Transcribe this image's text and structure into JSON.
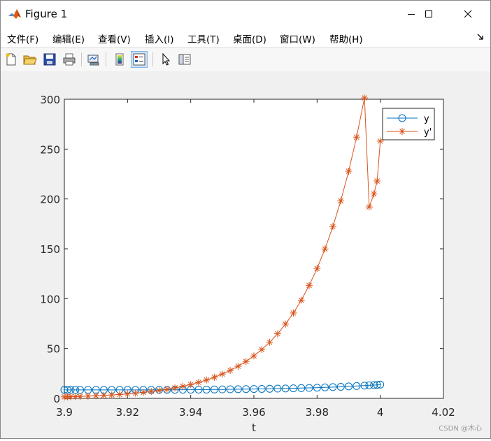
{
  "window": {
    "title": "Figure 1",
    "controls": {
      "minimize": "minimize",
      "maximize": "maximize",
      "close": "close"
    }
  },
  "menu": {
    "items": [
      {
        "label": "文件(F)"
      },
      {
        "label": "编辑(E)"
      },
      {
        "label": "查看(V)"
      },
      {
        "label": "插入(I)"
      },
      {
        "label": "工具(T)"
      },
      {
        "label": "桌面(D)"
      },
      {
        "label": "窗口(W)"
      },
      {
        "label": "帮助(H)"
      }
    ]
  },
  "toolbar": {
    "buttons": [
      {
        "icon": "new-figure-icon"
      },
      {
        "icon": "open-folder-icon"
      },
      {
        "icon": "save-icon"
      },
      {
        "icon": "print-icon"
      },
      {
        "icon": "link-plot-icon"
      },
      {
        "icon": "colorbar-icon"
      },
      {
        "icon": "legend-icon",
        "pressed": true
      },
      {
        "icon": "edit-plot-arrow-icon"
      },
      {
        "icon": "property-inspector-icon"
      }
    ]
  },
  "chart_data": {
    "type": "line",
    "xlabel": "t",
    "ylabel": "",
    "xlim": [
      3.9,
      4.02
    ],
    "ylim": [
      0,
      300
    ],
    "xticks": [
      "3.9",
      "3.92",
      "3.94",
      "3.96",
      "3.98",
      "4",
      "4.02"
    ],
    "yticks": [
      "0",
      "50",
      "100",
      "150",
      "200",
      "250",
      "300"
    ],
    "legend_position": "top-right",
    "series": [
      {
        "name": "y",
        "color": "#0072bd",
        "marker": "circle",
        "x": [
          3.9,
          3.901,
          3.902,
          3.9035,
          3.905,
          3.9075,
          3.91,
          3.9125,
          3.915,
          3.9175,
          3.92,
          3.9225,
          3.925,
          3.9275,
          3.93,
          3.9325,
          3.935,
          3.9375,
          3.94,
          3.9425,
          3.945,
          3.9475,
          3.95,
          3.9525,
          3.955,
          3.9575,
          3.96,
          3.9625,
          3.965,
          3.9675,
          3.97,
          3.9725,
          3.975,
          3.9775,
          3.98,
          3.9825,
          3.985,
          3.9875,
          3.99,
          3.9925,
          3.995,
          3.9965,
          3.998,
          3.999,
          4.0
        ],
        "y": [
          8.5,
          8.5,
          8.5,
          8.5,
          8.5,
          8.5,
          8.5,
          8.5,
          8.5,
          8.5,
          8.5,
          8.5,
          8.5,
          8.5,
          8.6,
          8.6,
          8.6,
          8.7,
          8.7,
          8.8,
          8.8,
          8.9,
          9.0,
          9.1,
          9.2,
          9.3,
          9.4,
          9.5,
          9.6,
          9.8,
          9.9,
          10.1,
          10.3,
          10.5,
          10.7,
          11.0,
          11.3,
          11.6,
          12.0,
          12.4,
          12.8,
          13.1,
          13.3,
          13.5,
          13.8
        ]
      },
      {
        "name": "y'",
        "color": "#d95319",
        "marker": "asterisk",
        "x": [
          3.9,
          3.901,
          3.902,
          3.9035,
          3.905,
          3.9075,
          3.91,
          3.9125,
          3.915,
          3.9175,
          3.92,
          3.9225,
          3.925,
          3.9275,
          3.93,
          3.9325,
          3.935,
          3.9375,
          3.94,
          3.9425,
          3.945,
          3.9475,
          3.95,
          3.9525,
          3.955,
          3.9575,
          3.96,
          3.9625,
          3.965,
          3.9675,
          3.97,
          3.9725,
          3.975,
          3.9775,
          3.98,
          3.9825,
          3.985,
          3.9875,
          3.99,
          3.9925,
          3.995,
          3.9965,
          3.998,
          3.999,
          4.0
        ],
        "y": [
          1.5,
          1.6,
          1.7,
          1.8,
          2.0,
          2.3,
          2.6,
          3.0,
          3.4,
          3.9,
          4.5,
          5.2,
          6.0,
          6.9,
          7.9,
          9.1,
          10.5,
          12.1,
          13.9,
          16.0,
          18.4,
          21.2,
          24.4,
          28.0,
          32.2,
          37.0,
          42.6,
          49.0,
          56.3,
          64.8,
          74.5,
          85.6,
          98.5,
          113.3,
          130.3,
          149.8,
          172.3,
          198.1,
          227.8,
          262.0,
          301.3,
          192.0,
          205.0,
          218.0,
          258.0
        ]
      }
    ]
  },
  "watermark": "CSDN @木心"
}
